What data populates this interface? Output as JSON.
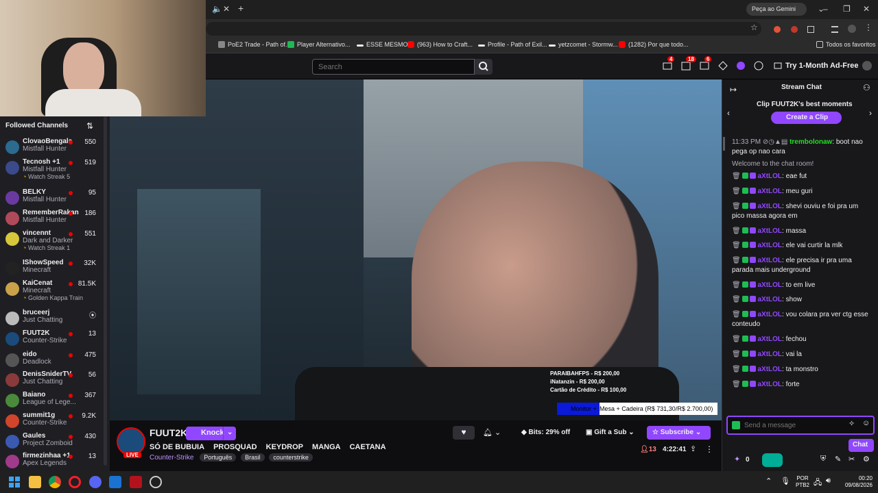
{
  "browser": {
    "gemini_label": "Peça ao Gemini",
    "bookmarks": [
      "PoE2 Trade - Path of...",
      "Player Alternativo...",
      "ESSE MESMO",
      "(963) How to Craft...",
      "Profile - Path of Exil...",
      "yetzcomet - Stormw...",
      "(1282) Por que todo..."
    ],
    "all_bookmarks": "Todos os favoritos"
  },
  "twitch_nav": {
    "search_placeholder": "Search",
    "badges": [
      "4",
      "18",
      "6"
    ],
    "adfree_label": "Try 1-Month Ad-Free"
  },
  "sidebar": {
    "title": "Followed Channels",
    "channels": [
      {
        "name": "ClovaoBengala",
        "game": "Mistfall Hunter",
        "viewers": "550",
        "extra": ""
      },
      {
        "name": "Tecnosh +1",
        "game": "Mistfall Hunter",
        "viewers": "519",
        "extra": "Watch Streak 5"
      },
      {
        "name": "BELKY",
        "game": "Mistfall Hunter",
        "viewers": "95",
        "extra": ""
      },
      {
        "name": "RememberRakan",
        "game": "Mistfall Hunter",
        "viewers": "186",
        "extra": ""
      },
      {
        "name": "vincennt",
        "game": "Dark and Darker",
        "viewers": "551",
        "extra": "Watch Streak 1"
      },
      {
        "name": "IShowSpeed",
        "game": "Minecraft",
        "viewers": "32K",
        "extra": ""
      },
      {
        "name": "KaiCenat",
        "game": "Minecraft",
        "viewers": "81.5K",
        "extra": "Golden Kappa Train"
      },
      {
        "name": "bruceerj",
        "game": "Just Chatting",
        "viewers": "",
        "extra": ""
      },
      {
        "name": "FUUT2K",
        "game": "Counter-Strike",
        "viewers": "13",
        "extra": ""
      },
      {
        "name": "eido",
        "game": "Deadlock",
        "viewers": "475",
        "extra": ""
      },
      {
        "name": "DenisSniderTV",
        "game": "Just Chatting",
        "viewers": "56",
        "extra": ""
      },
      {
        "name": "Baiano",
        "game": "League of Lege...",
        "viewers": "367",
        "extra": ""
      },
      {
        "name": "summit1g",
        "game": "Counter-Strike",
        "viewers": "9.2K",
        "extra": ""
      },
      {
        "name": "Gaules",
        "game": "Project Zomboid",
        "viewers": "430",
        "extra": ""
      },
      {
        "name": "firmezinhaa +1",
        "game": "Apex Legends",
        "viewers": "13",
        "extra": ""
      }
    ]
  },
  "video_overlay": {
    "donations": [
      "PARAIBAHFPS - R$ 200,00",
      "iNatanzin - R$ 200,00",
      "Cartão de Crédito - R$ 100,00"
    ],
    "goal_prefix": "Monitor +",
    "goal": "Mesa + Cadeira (R$ 731,30/R$ 2.700,00)"
  },
  "stream": {
    "channel": "FUUT2K",
    "knock_label": "Knock",
    "title_tags": [
      "SÓ DE BUBUIA",
      "PROSQUAD",
      "KEYDROP",
      "MANGA",
      "CAETANA"
    ],
    "live_label": "LIVE",
    "category": "Counter-Strike",
    "tags": [
      "Português",
      "Brasil",
      "counterstrike"
    ],
    "bits_label": "Bits: 29% off",
    "gift_label": "Gift a Sub",
    "subscribe_label": "Subscribe",
    "viewers": "13",
    "uptime": "4:22:41"
  },
  "chat": {
    "title": "Stream Chat",
    "clip_title": "Clip FUUT2K's best moments",
    "create_clip": "Create a Clip",
    "first_msg": {
      "time": "11:33 PM",
      "user": "trembolonaw",
      "text": "boot nao pega op nao cara"
    },
    "welcome": "Welcome to the chat room!",
    "messages": [
      {
        "user": "aXtLOL",
        "text": "eae fut"
      },
      {
        "user": "aXtLOL",
        "text": "meu guri"
      },
      {
        "user": "aXtLOL",
        "text": "shevi ouviu e foi pra um pico massa agora em"
      },
      {
        "user": "aXtLOL",
        "text": "massa"
      },
      {
        "user": "aXtLOL",
        "text": "ele vai curtir la mlk"
      },
      {
        "user": "aXtLOL",
        "text": "ele precisa ir pra uma parada mais underground"
      },
      {
        "user": "aXtLOL",
        "text": "to em live"
      },
      {
        "user": "aXtLOL",
        "text": "show"
      },
      {
        "user": "aXtLOL",
        "text": "vou colara pra ver ctg esse conteudo"
      },
      {
        "user": "aXtLOL",
        "text": "fechou"
      },
      {
        "user": "aXtLOL",
        "text": "vai la"
      },
      {
        "user": "aXtLOL",
        "text": "ta monstro"
      },
      {
        "user": "aXtLOL",
        "text": "forte"
      }
    ],
    "input_placeholder": "Send a message",
    "points": "0",
    "chat_button": "Chat"
  },
  "taskbar": {
    "lang": "POR",
    "layout": "PTB2",
    "time": "00:20",
    "date": "09/08/2026"
  },
  "colors": {
    "twitch_purple": "#9147ff",
    "live_red": "#eb0400",
    "bg": "#0e0e10"
  }
}
